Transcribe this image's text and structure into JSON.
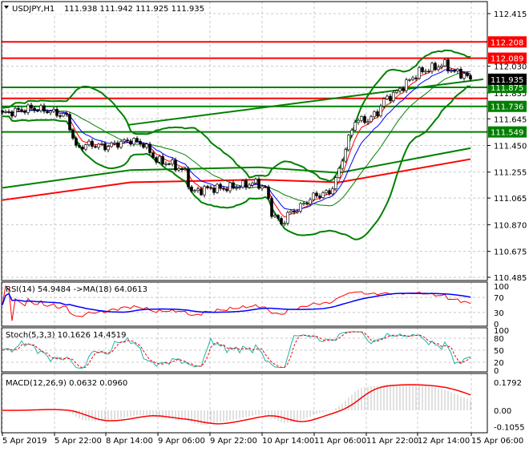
{
  "header": {
    "symbol": "USDJPY,H1",
    "ohlc": "111.938 111.942 111.925 111.935"
  },
  "chart_data": {
    "type": "candlestick",
    "title": "USDJPY,H1",
    "price_ticks": [
      "112.415",
      "112.030",
      "111.835",
      "111.645",
      "111.450",
      "111.255",
      "111.065",
      "110.870",
      "110.675",
      "110.485"
    ],
    "price_range": [
      110.485,
      112.415
    ],
    "current_price": {
      "label": "111.935",
      "value": 111.935
    },
    "levels": [
      {
        "label": "112.208",
        "value": 112.208,
        "color": "#ff0000"
      },
      {
        "label": "112.089",
        "value": 112.089,
        "color": "#ff0000"
      },
      {
        "label": "111.875",
        "value": 111.875,
        "color": "#008000"
      },
      {
        "label": "",
        "value": 111.795,
        "color": "#ff0000"
      },
      {
        "label": "111.736",
        "value": 111.736,
        "color": "#008000"
      },
      {
        "label": "111.549",
        "value": 111.549,
        "color": "#008000"
      }
    ],
    "close_waypoints": [
      [
        0,
        111.682
      ],
      [
        9,
        111.723
      ],
      [
        14,
        111.705
      ],
      [
        20,
        111.664
      ],
      [
        23,
        111.43
      ],
      [
        27,
        111.459
      ],
      [
        32,
        111.441
      ],
      [
        37,
        111.471
      ],
      [
        40,
        111.488
      ],
      [
        44,
        111.459
      ],
      [
        48,
        111.342
      ],
      [
        53,
        111.312
      ],
      [
        57,
        111.254
      ],
      [
        59,
        111.107
      ],
      [
        64,
        111.136
      ],
      [
        69,
        111.136
      ],
      [
        74,
        111.154
      ],
      [
        79,
        111.177
      ],
      [
        82,
        111.136
      ],
      [
        84,
        110.96
      ],
      [
        87,
        110.873
      ],
      [
        89,
        110.943
      ],
      [
        93,
        111.002
      ],
      [
        97,
        111.078
      ],
      [
        102,
        111.107
      ],
      [
        104,
        111.195
      ],
      [
        107,
        111.43
      ],
      [
        110,
        111.635
      ],
      [
        114,
        111.635
      ],
      [
        117,
        111.694
      ],
      [
        119,
        111.781
      ],
      [
        123,
        111.84
      ],
      [
        127,
        111.928
      ],
      [
        130,
        111.987
      ],
      [
        134,
        112.016
      ],
      [
        138,
        112.045
      ],
      [
        140,
        111.999
      ],
      [
        144,
        111.969
      ],
      [
        146,
        111.935
      ]
    ],
    "trend_lines": [
      {
        "name": "trendline",
        "color": "#008000",
        "points": [
          [
            39,
            111.6
          ],
          [
            150,
            111.935
          ]
        ]
      },
      {
        "name": "ma-long-green",
        "color": "#008000",
        "points": [
          [
            0,
            111.14
          ],
          [
            40,
            111.27
          ],
          [
            80,
            111.29
          ],
          [
            105,
            111.25
          ],
          [
            146,
            111.43
          ]
        ]
      },
      {
        "name": "ma-long-red",
        "color": "#ff0000",
        "points": [
          [
            0,
            111.05
          ],
          [
            40,
            111.18
          ],
          [
            80,
            111.2
          ],
          [
            105,
            111.18
          ],
          [
            146,
            111.35
          ]
        ]
      }
    ],
    "time_labels": [
      "5 Apr 2019",
      "5 Apr 22:00",
      "8 Apr 14:00",
      "9 Apr 06:00",
      "9 Apr 22:00",
      "10 Apr 14:00",
      "11 Apr 06:00",
      "11 Apr 22:00",
      "12 Apr 14:00",
      "15 Apr 06:00"
    ]
  },
  "rsi": {
    "label": "RSI(14) 54.9484  ->MA(18) 64.0613",
    "ticks": [
      "100",
      "70",
      "30",
      "0"
    ]
  },
  "stoch": {
    "label": "Stoch(5,3,3) 10.1626 14.4519",
    "ticks": [
      "100",
      "80",
      "50",
      "20",
      "0"
    ]
  },
  "macd": {
    "label": "MACD(12,26,9) 0.0632 0.0960",
    "ticks": [
      "0.1792",
      "0.00",
      "-0.1055"
    ]
  },
  "colors": {
    "bb": "#008000",
    "ema_fast": "#ff0000",
    "ema_slow": "#0000ff",
    "rsi": "#ff0000",
    "rsi_ma": "#0000ff",
    "stoch_main": "#20b2aa",
    "stoch_signal": "#ff0000",
    "macd_hist": "#c0c0c0",
    "macd_signal": "#ff0000"
  }
}
